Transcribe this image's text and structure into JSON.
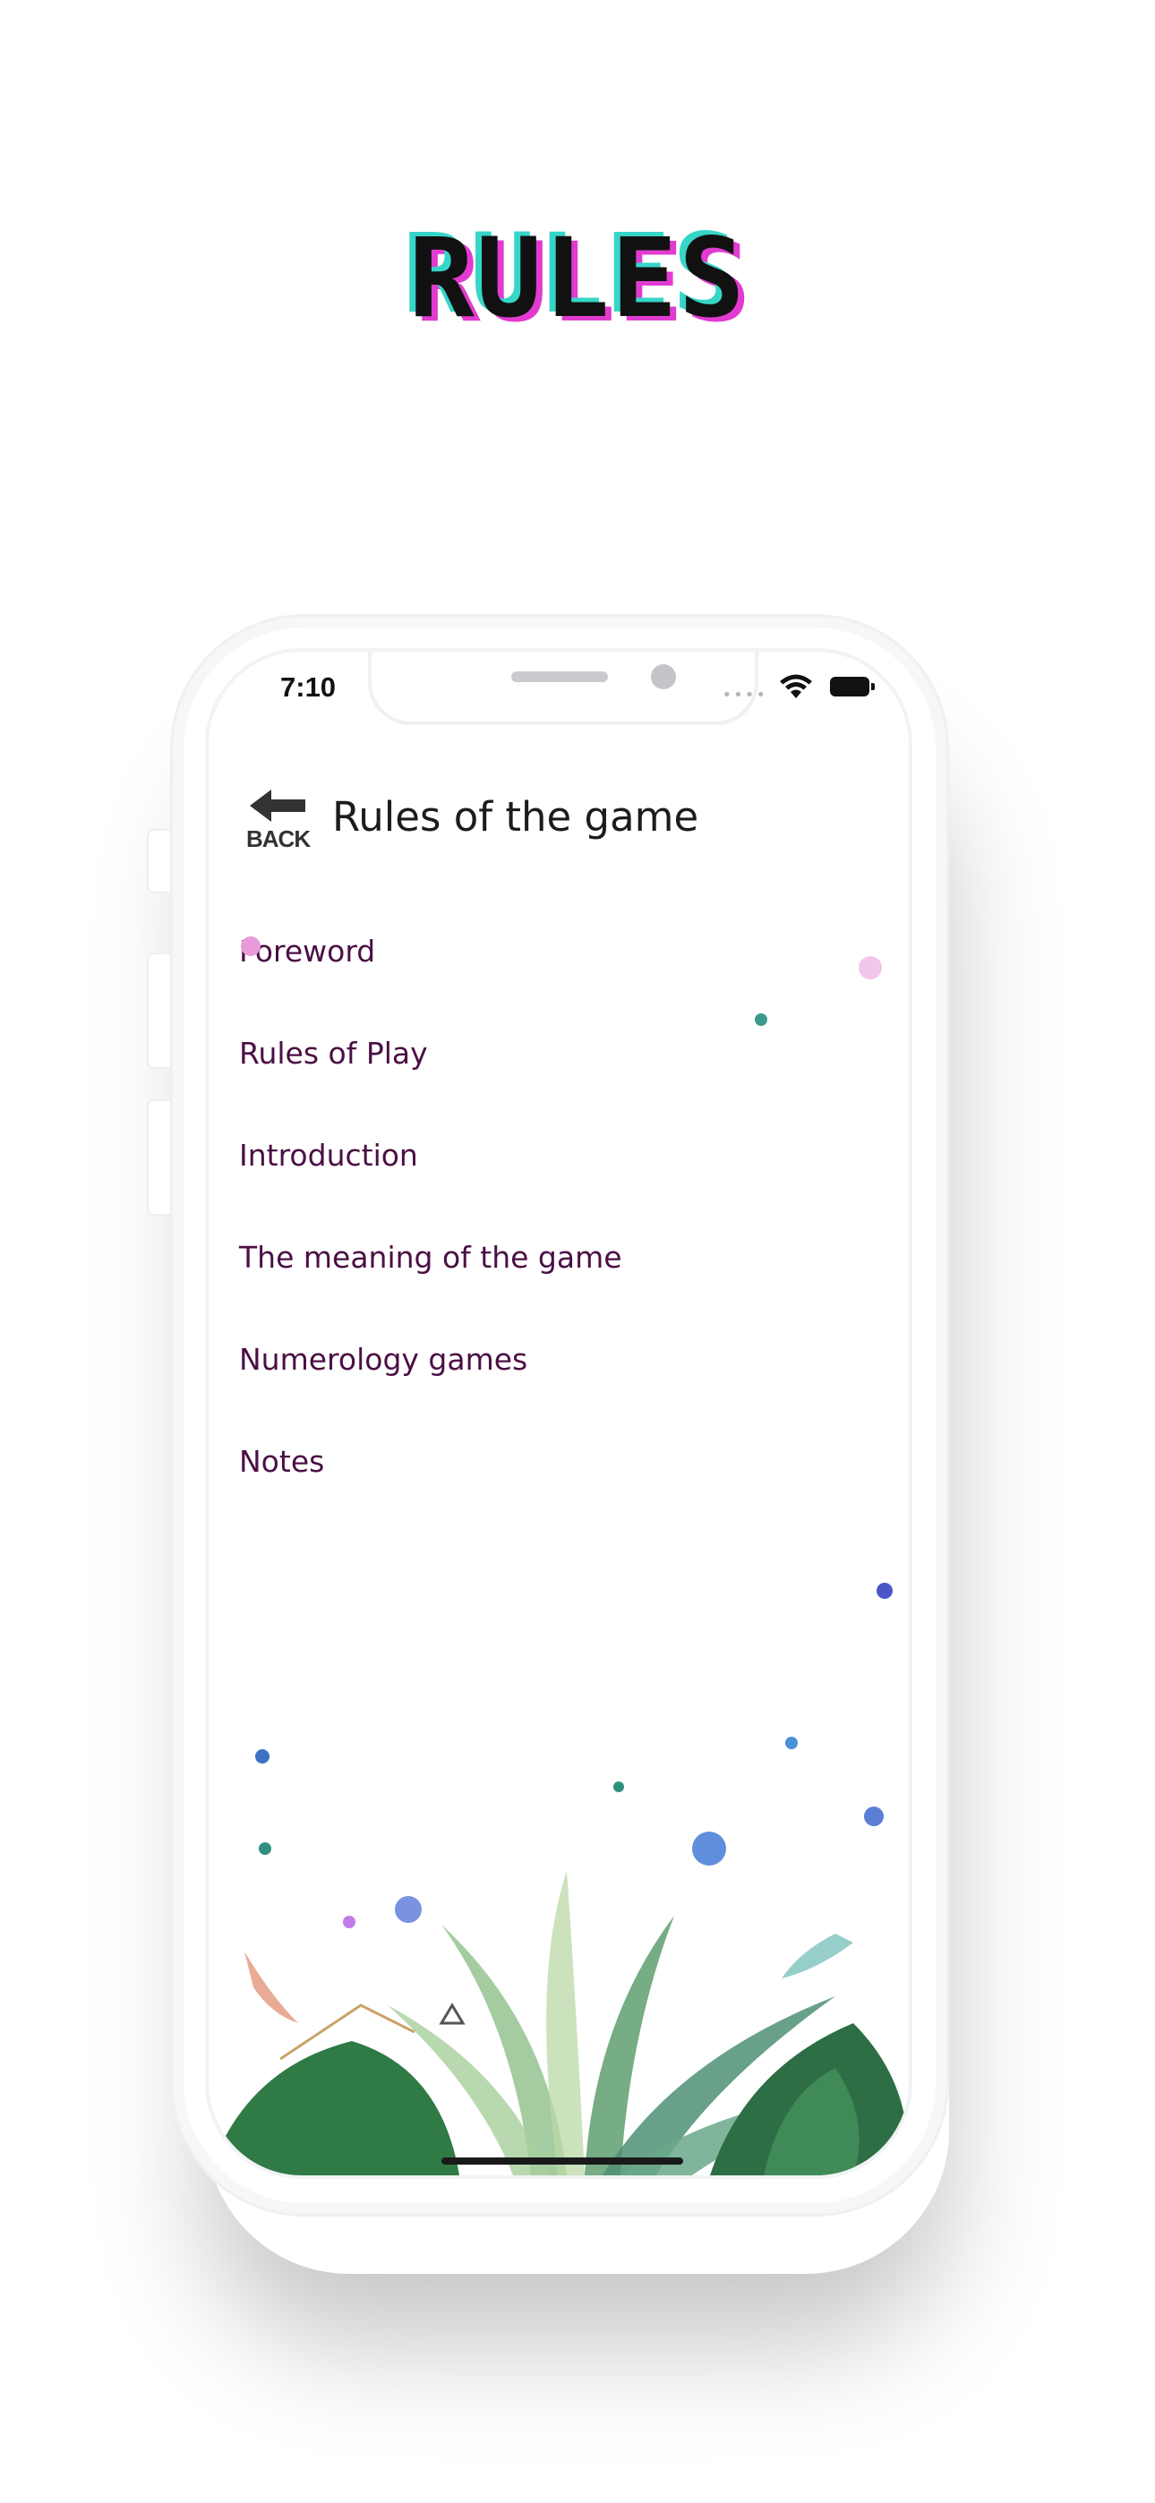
{
  "hero": {
    "title": "RULES"
  },
  "status_bar": {
    "time": "7:10"
  },
  "header": {
    "back_label": "BACK",
    "title": "Rules of the game"
  },
  "menu": {
    "items": [
      {
        "label": "Foreword"
      },
      {
        "label": "Rules of Play"
      },
      {
        "label": "Introduction"
      },
      {
        "label": "The meaning of the game"
      },
      {
        "label": "Numerology games"
      },
      {
        "label": "Notes"
      }
    ]
  },
  "colors": {
    "menu_text": "#4b0f44",
    "glitch_cyan": "#35d6c8",
    "glitch_magenta": "#e13bd0"
  }
}
